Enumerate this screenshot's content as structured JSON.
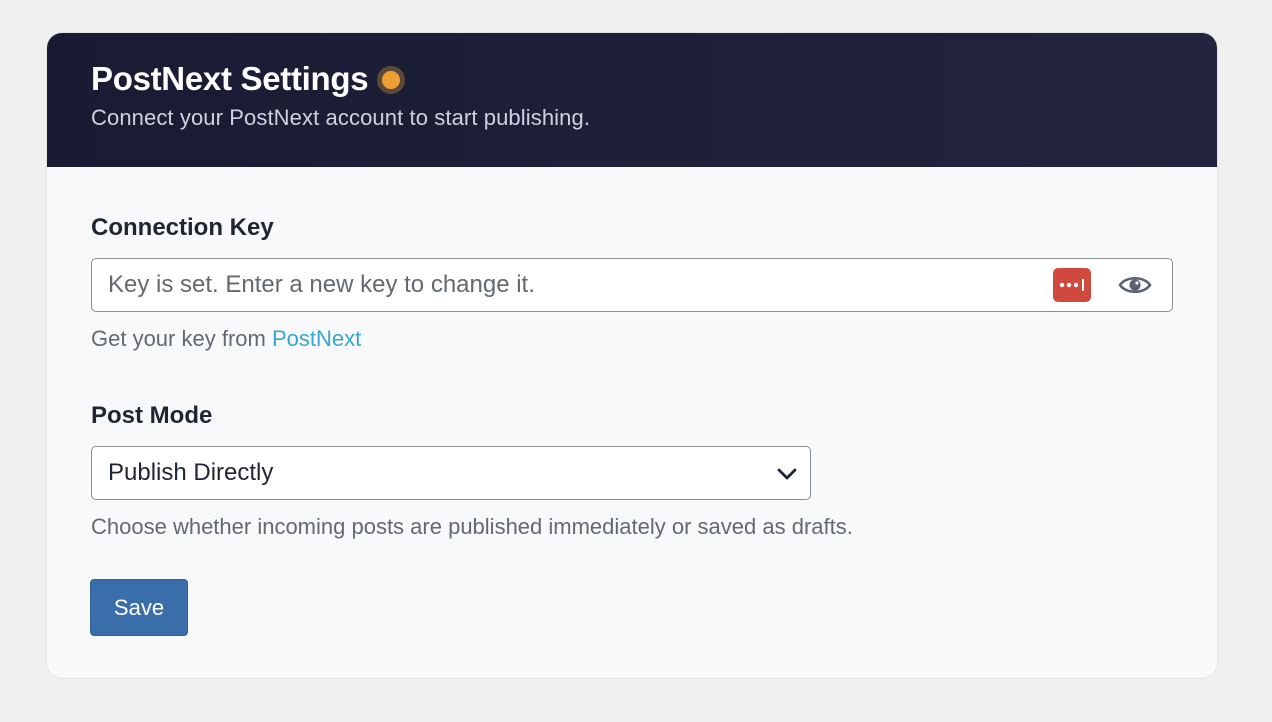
{
  "header": {
    "title": "PostNext Settings",
    "subtitle": "Connect your PostNext account to start publishing.",
    "status_color": "#f0a033"
  },
  "connection_key": {
    "label": "Connection Key",
    "value": "",
    "placeholder": "Key is set. Enter a new key to change it.",
    "password_manager_icon": "password-dots-icon",
    "toggle_icon": "eye-icon",
    "helper_prefix": "Get your key from ",
    "helper_link": "PostNext"
  },
  "post_mode": {
    "label": "Post Mode",
    "selected": "Publish Directly",
    "helper": "Choose whether incoming posts are published immediately or saved as drafts."
  },
  "actions": {
    "save_label": "Save"
  },
  "colors": {
    "header_bg": "#1b1d35",
    "accent": "#3a6eab",
    "link": "#3aa6cf",
    "password_icon_bg": "#d0493f"
  }
}
